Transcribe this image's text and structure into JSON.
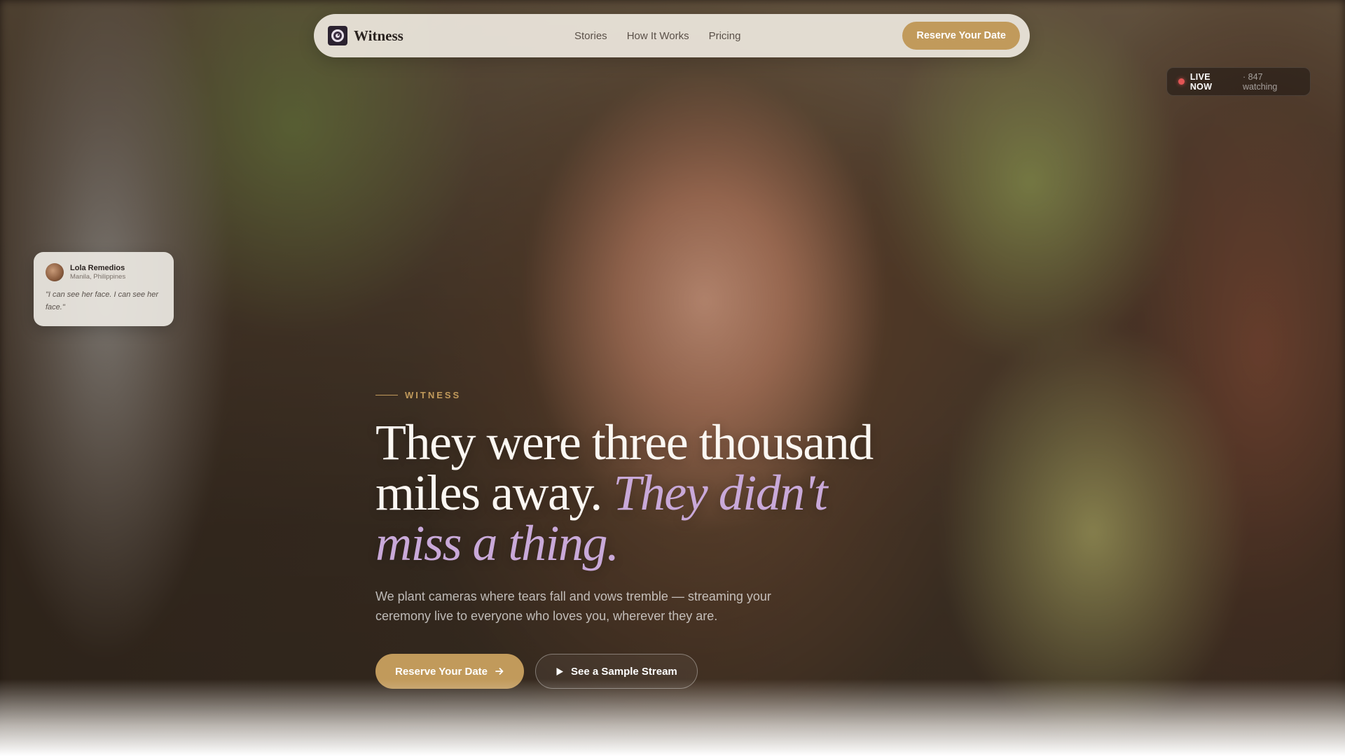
{
  "nav": {
    "brand": "Witness",
    "links": [
      "Stories",
      "How It Works",
      "Pricing"
    ],
    "cta_label": "Reserve Your Date"
  },
  "live_badge": {
    "label": "LIVE NOW",
    "count": "· 847 watching"
  },
  "testimonial": {
    "name": "Lola Remedios",
    "location": "Manila, Philippines",
    "quote": "\"I can see her face. I can see her face.\""
  },
  "hero": {
    "eyebrow": "WITNESS",
    "headline_plain": "They were three thousand miles away. ",
    "headline_accent": "They didn't miss a thing.",
    "subhead": "We plant cameras where tears fall and vows tremble — streaming your ceremony live to everyone who loves you, wherever they are.",
    "primary_cta": "Reserve Your Date",
    "secondary_cta": "See a Sample Stream"
  },
  "colors": {
    "accent_gold": "#c19a5b",
    "accent_lilac": "#c9a9d9",
    "live_red": "#e25555"
  },
  "icons": {
    "logo": "eye-icon",
    "primary_cta": "arrow-right-icon",
    "secondary_cta": "play-icon",
    "live": "live-dot-icon"
  }
}
